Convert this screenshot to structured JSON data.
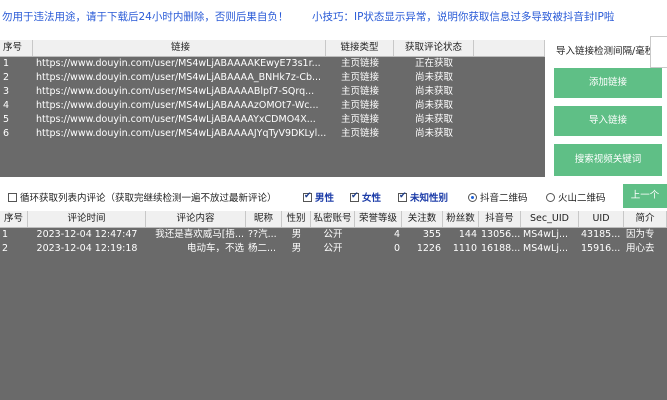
{
  "notice": {
    "warning": "勿用于违法用途，请于下载后24小时内删除，否则后果自负！",
    "tip": "小技巧：IP状态显示异常，说明你获取信息过多导致被抖音封IP啦"
  },
  "links_table": {
    "headers": [
      "序号",
      "链接",
      "链接类型",
      "获取评论状态"
    ],
    "rows": [
      {
        "no": "1",
        "url": "https://www.douyin.com/user/MS4wLjABAAAAKEwyE73s1r...",
        "type": "主页链接",
        "status": "正在获取"
      },
      {
        "no": "2",
        "url": "https://www.douyin.com/user/MS4wLjABAAAA_BNHk7z-Cb...",
        "type": "主页链接",
        "status": "尚未获取"
      },
      {
        "no": "3",
        "url": "https://www.douyin.com/user/MS4wLjABAAAABlpf7-SQrq...",
        "type": "主页链接",
        "status": "尚未获取"
      },
      {
        "no": "4",
        "url": "https://www.douyin.com/user/MS4wLjABAAAAzOMOt7-Wc...",
        "type": "主页链接",
        "status": "尚未获取"
      },
      {
        "no": "5",
        "url": "https://www.douyin.com/user/MS4wLjABAAAAYxCDMO4X...",
        "type": "主页链接",
        "status": "尚未获取"
      },
      {
        "no": "6",
        "url": "https://www.douyin.com/user/MS4wLjABAAAAJYqTyV9DKLyl...",
        "type": "主页链接",
        "status": "尚未获取"
      }
    ]
  },
  "right_panel": {
    "title": "导入链接检测间隔/毫秒",
    "add_link": "添加链接",
    "import_link": "导入链接",
    "search_keyword": "搜索视频关键词"
  },
  "options": {
    "loop": "循环获取列表内评论（获取完继续检测一遍不放过最新评论）",
    "male": "男性",
    "female": "女性",
    "unknown_gender": "未知性别",
    "douyin_qr": "抖音二维码",
    "huoshan_qr": "火山二维码",
    "prev": "上一个"
  },
  "comments_table": {
    "headers": [
      "序号",
      "评论时间",
      "评论内容",
      "昵称",
      "性别",
      "私密账号",
      "荣誉等级",
      "关注数",
      "粉丝数",
      "抖音号",
      "Sec_UID",
      "UID",
      "简介"
    ],
    "rows": [
      {
        "no": "1",
        "time": "2023-12-04 12:47:47",
        "content": "我还是喜欢威马[捂...",
        "nick": "??汽...",
        "gender": "男",
        "private": "公开",
        "level": "4",
        "follow": "355",
        "fans": "144",
        "dyid": "13056...",
        "secuid": "MS4wLj...",
        "uid": "43185...",
        "bio": "因为专"
      },
      {
        "no": "2",
        "time": "2023-12-04 12:19:18",
        "content": "电动车，不选",
        "nick": "杨二...",
        "gender": "男",
        "private": "公开",
        "level": "0",
        "follow": "1226",
        "fans": "1110",
        "dyid": "16188...",
        "secuid": "MS4wLj...",
        "uid": "15916...",
        "bio": "用心去"
      }
    ]
  },
  "colors": {
    "accent_green": "#5fbf86",
    "table_bg": "#6a6a6a",
    "notice_blue": "#2a5bd7"
  }
}
